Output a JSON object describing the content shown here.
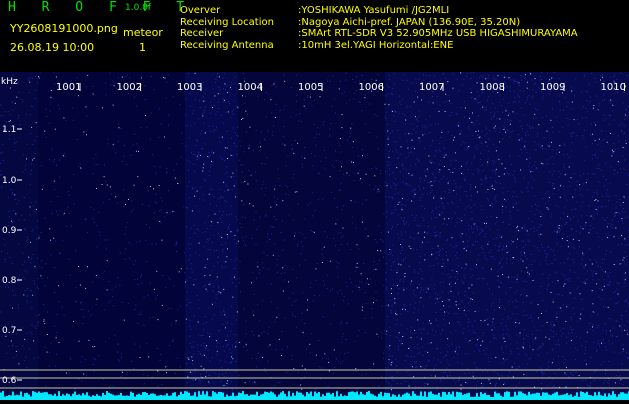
{
  "header": {
    "app_title": "H R O F F T",
    "version": "1.0.0f",
    "filename": "YY2608191000.png",
    "datetime": "26.08.19 10:00",
    "meteor_label": "meteor",
    "meteor_count": "1",
    "info": [
      {
        "key": "Overver",
        "value": ":YOSHIKAWA Yasufumi /JG2MLI"
      },
      {
        "key": "Receiving Location",
        "value": ":Nagoya Aichi-pref. JAPAN (136.90E, 35.20N)"
      },
      {
        "key": "Receiver",
        "value": ":SMArt RTL-SDR V3 52.905MHz USB HIGASHIMURAYAMA"
      },
      {
        "key": "Receiving Antenna",
        "value": ":10mH 3el.YAGI Horizontal:ENE"
      }
    ]
  },
  "spectrogram": {
    "y_unit": "kHz",
    "y_ticks": [
      "1.1",
      "1.0",
      "0.9",
      "0.8",
      "0.7",
      "0.6"
    ],
    "time_labels": [
      "1001",
      "1002",
      "1003",
      "1004",
      "1005",
      "1006",
      "1007",
      "1008",
      "1009",
      "1010"
    ],
    "colors": {
      "background": "#00002e",
      "noise": "#1a2aa8",
      "bright": "#a8c8ff",
      "baseline": "#00e8ff",
      "marker_line": "#c8c8a0",
      "axis_text": "#ffffff"
    }
  }
}
